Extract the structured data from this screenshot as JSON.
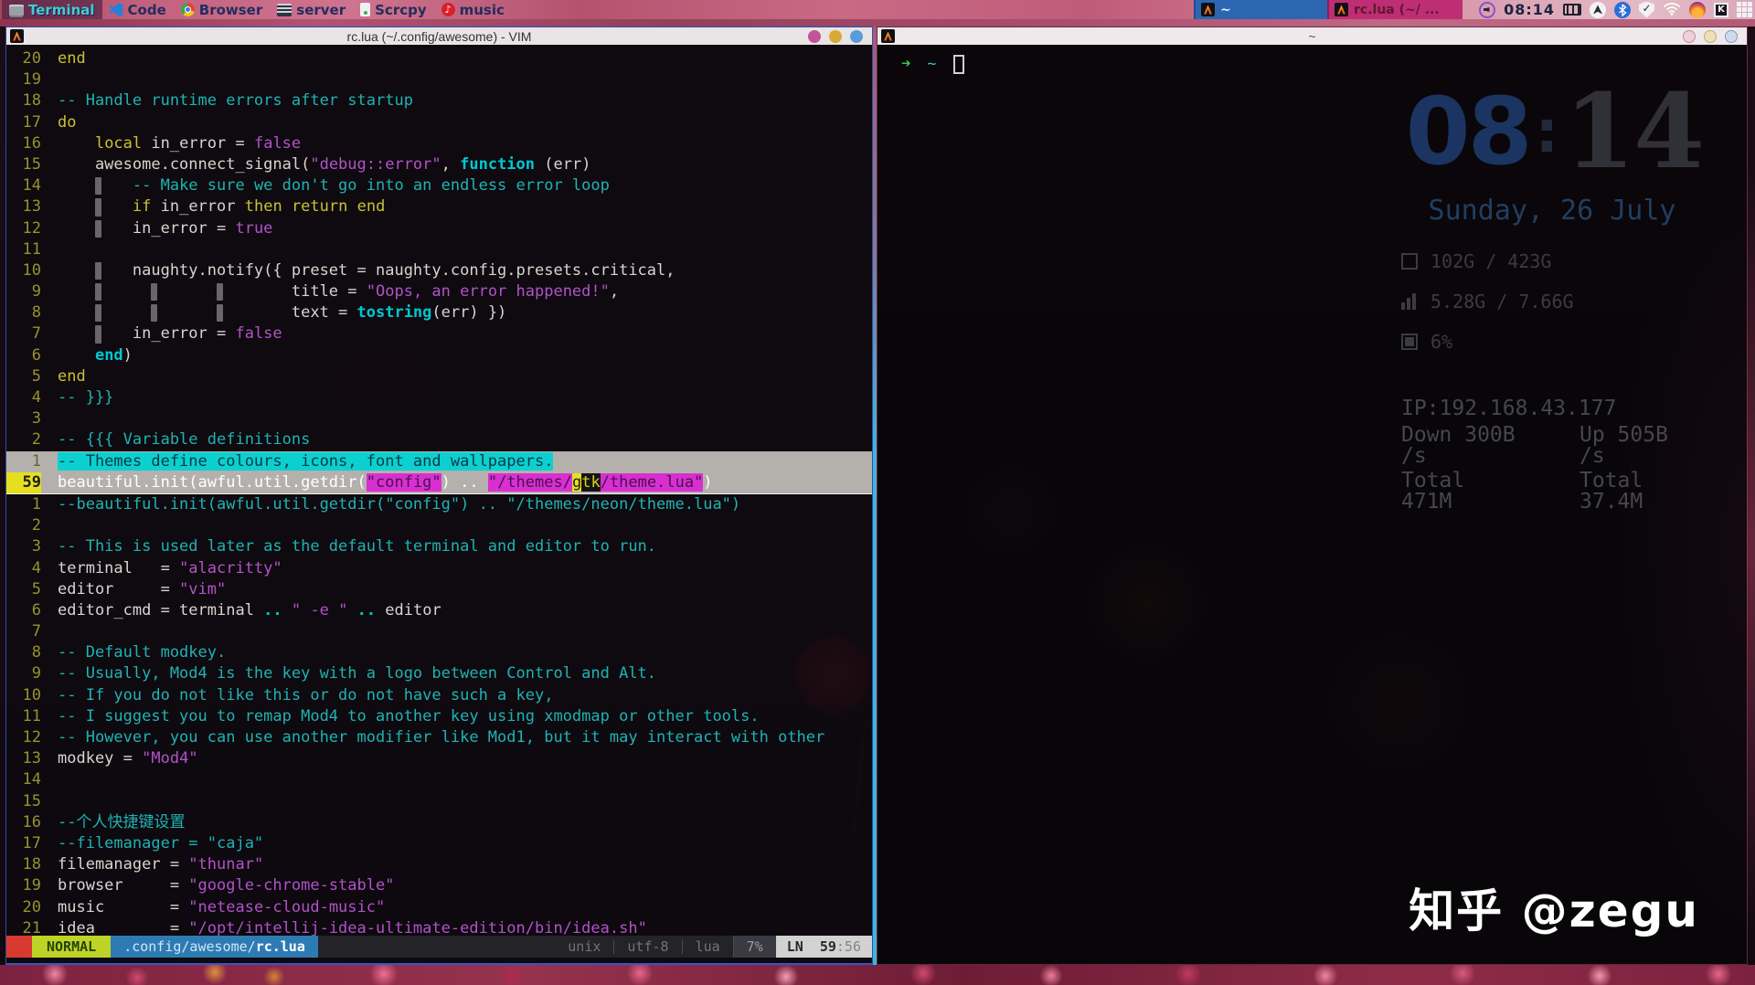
{
  "colors": {
    "accent_cyan": "#41b4dc",
    "accent_magenta": "#be2e74",
    "accent_blue": "#2d66b0",
    "mode_green": "#bfd327",
    "statusline_blue": "#2e7bb4",
    "cursorline_gray": "#b4b1ad",
    "search_magenta": "#d92fd0",
    "search_cyan": "#0cd0d0",
    "cursor_yellow": "#e6df1d"
  },
  "topbar": {
    "tags": [
      {
        "label": "Terminal",
        "icon": "terminal-icon",
        "selected": true
      },
      {
        "label": "Code",
        "icon": "vscode-icon",
        "selected": false
      },
      {
        "label": "Browser",
        "icon": "chrome-icon",
        "selected": false
      },
      {
        "label": "server",
        "icon": "server-icon",
        "selected": false
      },
      {
        "label": "Scrcpy",
        "icon": "phone-icon",
        "selected": false
      },
      {
        "label": "music",
        "icon": "netease-icon",
        "selected": false
      }
    ],
    "tasks": [
      {
        "label": "~",
        "icon": "awesome-icon"
      },
      {
        "label": "rc.lua (~/ ...",
        "icon": "awesome-icon"
      }
    ],
    "clock": "08:14",
    "tray": [
      "volume-icon",
      "keyboard-icon",
      "app-circle-icon",
      "bluetooth-icon",
      "shield-icon",
      "wifi-icon",
      "flame-icon",
      "fcitx-k-icon",
      "grid-icon"
    ]
  },
  "vim": {
    "title": "rc.lua (~/.config/awesome) - VIM",
    "lines": [
      {
        "n": "20",
        "t": [
          [
            "kw",
            "end"
          ]
        ]
      },
      {
        "n": "19",
        "t": []
      },
      {
        "n": "18",
        "t": [
          [
            "cm",
            "-- Handle runtime errors after startup"
          ]
        ]
      },
      {
        "n": "17",
        "t": [
          [
            "kw",
            "do"
          ]
        ]
      },
      {
        "n": "16",
        "t": [
          [
            "id",
            "    "
          ],
          [
            "kw",
            "local"
          ],
          [
            "id",
            " in_error = "
          ],
          [
            "bool",
            "false"
          ]
        ]
      },
      {
        "n": "15",
        "t": [
          [
            "id",
            "    awesome.connect_signal("
          ],
          [
            "st",
            "\"debug::error\""
          ],
          [
            "id",
            ", "
          ],
          [
            "fn",
            "function"
          ],
          [
            "id",
            " (err)"
          ]
        ]
      },
      {
        "n": "14",
        "g": [
          4
        ],
        "t": [
          [
            "id",
            "        "
          ],
          [
            "cm",
            "-- Make sure we don't go into an endless error loop"
          ]
        ]
      },
      {
        "n": "13",
        "g": [
          4
        ],
        "t": [
          [
            "id",
            "        "
          ],
          [
            "kw",
            "if"
          ],
          [
            "id",
            " in_error "
          ],
          [
            "kw",
            "then"
          ],
          [
            "id",
            " "
          ],
          [
            "kw",
            "return"
          ],
          [
            "id",
            " "
          ],
          [
            "kw",
            "end"
          ]
        ]
      },
      {
        "n": "12",
        "g": [
          4
        ],
        "t": [
          [
            "id",
            "        in_error = "
          ],
          [
            "bool",
            "true"
          ]
        ]
      },
      {
        "n": "11",
        "t": []
      },
      {
        "n": "10",
        "g": [
          4
        ],
        "t": [
          [
            "id",
            "        naughty.notify({ preset = naughty.config.presets.critical,"
          ]
        ]
      },
      {
        "n": "9",
        "g": [
          4,
          10,
          17
        ],
        "t": [
          [
            "id",
            "                         title = "
          ],
          [
            "st",
            "\"Oops, an error happened!\""
          ],
          [
            "id",
            ","
          ]
        ]
      },
      {
        "n": "8",
        "g": [
          4,
          10,
          17
        ],
        "t": [
          [
            "id",
            "                         text = "
          ],
          [
            "fn",
            "tostring"
          ],
          [
            "id",
            "(err) })"
          ]
        ]
      },
      {
        "n": "7",
        "g": [
          4
        ],
        "t": [
          [
            "id",
            "        in_error = "
          ],
          [
            "bool",
            "false"
          ]
        ]
      },
      {
        "n": "6",
        "t": [
          [
            "id",
            "    "
          ],
          [
            "fn",
            "end"
          ],
          [
            "id",
            ")"
          ]
        ]
      },
      {
        "n": "5",
        "t": [
          [
            "kw",
            "end"
          ]
        ]
      },
      {
        "n": "4",
        "t": [
          [
            "cm",
            "-- }}}"
          ]
        ]
      },
      {
        "n": "3",
        "t": []
      },
      {
        "n": "2",
        "t": [
          [
            "cm",
            "-- {{{ Variable definitions"
          ]
        ]
      },
      {
        "n": "1",
        "row": "grayline",
        "t": [
          [
            "hlcyan",
            "-- Themes define colours, icons, font and wallpapers."
          ]
        ]
      },
      {
        "n": "59",
        "cur": true,
        "row": "cursorline",
        "t": [
          [
            "cl",
            "beautiful.init(awful.util.getdir("
          ],
          [
            "hlmag",
            "\"config\""
          ],
          [
            "cl",
            ") .. "
          ],
          [
            "hlmag",
            "\"/themes/"
          ],
          [
            "cur",
            "g"
          ],
          [
            "inc",
            "tk"
          ],
          [
            "hlmag",
            "/theme.lua\""
          ],
          [
            "cl",
            ")"
          ]
        ]
      },
      {
        "n": "1",
        "t": [
          [
            "cm",
            "--beautiful.init(awful.util.getdir(\"config\") .. \"/themes/neon/theme.lua\")"
          ]
        ]
      },
      {
        "n": "2",
        "t": []
      },
      {
        "n": "3",
        "t": [
          [
            "cm",
            "-- This is used later as the default terminal and editor to run."
          ]
        ]
      },
      {
        "n": "4",
        "t": [
          [
            "id",
            "terminal   = "
          ],
          [
            "st",
            "\"alacritty\""
          ]
        ]
      },
      {
        "n": "5",
        "t": [
          [
            "id",
            "editor     = "
          ],
          [
            "st",
            "\"vim\""
          ]
        ]
      },
      {
        "n": "6",
        "t": [
          [
            "id",
            "editor_cmd = terminal "
          ],
          [
            "fn",
            ".."
          ],
          [
            "id",
            " "
          ],
          [
            "st",
            "\" -e \""
          ],
          [
            "id",
            " "
          ],
          [
            "fn",
            ".."
          ],
          [
            "id",
            " editor"
          ]
        ]
      },
      {
        "n": "7",
        "t": []
      },
      {
        "n": "8",
        "t": [
          [
            "cm",
            "-- Default modkey."
          ]
        ]
      },
      {
        "n": "9",
        "t": [
          [
            "cm",
            "-- Usually, Mod4 is the key with a logo between Control and Alt."
          ]
        ]
      },
      {
        "n": "10",
        "t": [
          [
            "cm",
            "-- If you do not like this or do not have such a key,"
          ]
        ]
      },
      {
        "n": "11",
        "t": [
          [
            "cm",
            "-- I suggest you to remap Mod4 to another key using xmodmap or other tools."
          ]
        ]
      },
      {
        "n": "12",
        "t": [
          [
            "cm",
            "-- However, you can use another modifier like Mod1, but it may interact with other"
          ]
        ]
      },
      {
        "n": "13",
        "t": [
          [
            "id",
            "modkey = "
          ],
          [
            "st",
            "\"Mod4\""
          ]
        ]
      },
      {
        "n": "14",
        "t": []
      },
      {
        "n": "15",
        "t": []
      },
      {
        "n": "16",
        "t": [
          [
            "cm",
            "--个人快捷键设置"
          ]
        ]
      },
      {
        "n": "17",
        "t": [
          [
            "cm",
            "--filemanager = \"caja\""
          ]
        ]
      },
      {
        "n": "18",
        "t": [
          [
            "id",
            "filemanager = "
          ],
          [
            "st",
            "\"thunar\""
          ]
        ]
      },
      {
        "n": "19",
        "t": [
          [
            "id",
            "browser     = "
          ],
          [
            "st",
            "\"google-chrome-stable\""
          ]
        ]
      },
      {
        "n": "20",
        "t": [
          [
            "id",
            "music       = "
          ],
          [
            "st",
            "\"netease-cloud-music\""
          ]
        ]
      },
      {
        "n": "21",
        "t": [
          [
            "id",
            "idea        = "
          ],
          [
            "st",
            "\"/opt/intellij-idea-ultimate-edition/bin/idea.sh\""
          ]
        ]
      }
    ],
    "statusline": {
      "mode": "NORMAL",
      "dir": ".config/awesome/",
      "file": "rc.lua",
      "format": "unix",
      "encoding": "utf-8",
      "filetype": "lua",
      "percent": "7%",
      "ln_label": "LN",
      "pos_line": "59",
      "pos_col": ":56"
    }
  },
  "terminal": {
    "title": "~",
    "prompt_symbol": "➜",
    "path": "~"
  },
  "widgets": {
    "clock_hours": "08",
    "clock_colon": ":",
    "clock_minutes": "14",
    "date": "Sunday, 26 July",
    "disk": "102G / 423G",
    "memory": "5.28G / 7.66G",
    "cpu": "6%",
    "ip": "IP:192.168.43.177",
    "down": "Down 300B /s",
    "up": "Up 505B /s",
    "down_total": "Total 471M",
    "up_total": "Total 37.4M"
  },
  "watermark": "知乎 @zegu"
}
